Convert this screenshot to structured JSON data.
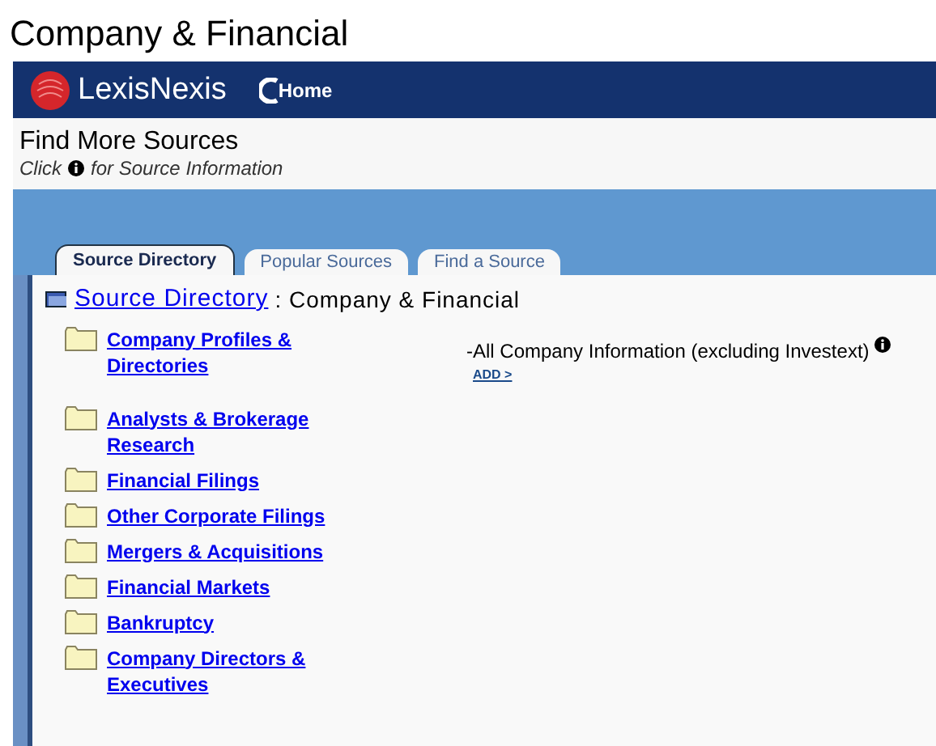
{
  "page_title": "Company & Financial",
  "header": {
    "logo_text": "LexisNexis",
    "home_label": "Home"
  },
  "section": {
    "title": "Find More Sources",
    "hint_before": "Click",
    "hint_after": "for Source Information"
  },
  "tabs": [
    {
      "label": "Source Directory",
      "selected": true
    },
    {
      "label": "Popular Sources",
      "selected": false
    },
    {
      "label": "Find a Source",
      "selected": false
    }
  ],
  "breadcrumb": {
    "link": "Source Directory",
    "current": ": Company & Financial"
  },
  "categories": [
    "Company Profiles & Directories",
    "Analysts & Brokerage Research",
    "Financial Filings",
    "Other Corporate Filings",
    "Mergers & Acquisitions",
    "Financial Markets",
    "Bankruptcy",
    "Company Directors & Executives"
  ],
  "sources": [
    {
      "name": "-All Company Information (excluding Investext)",
      "action": "ADD >"
    }
  ]
}
